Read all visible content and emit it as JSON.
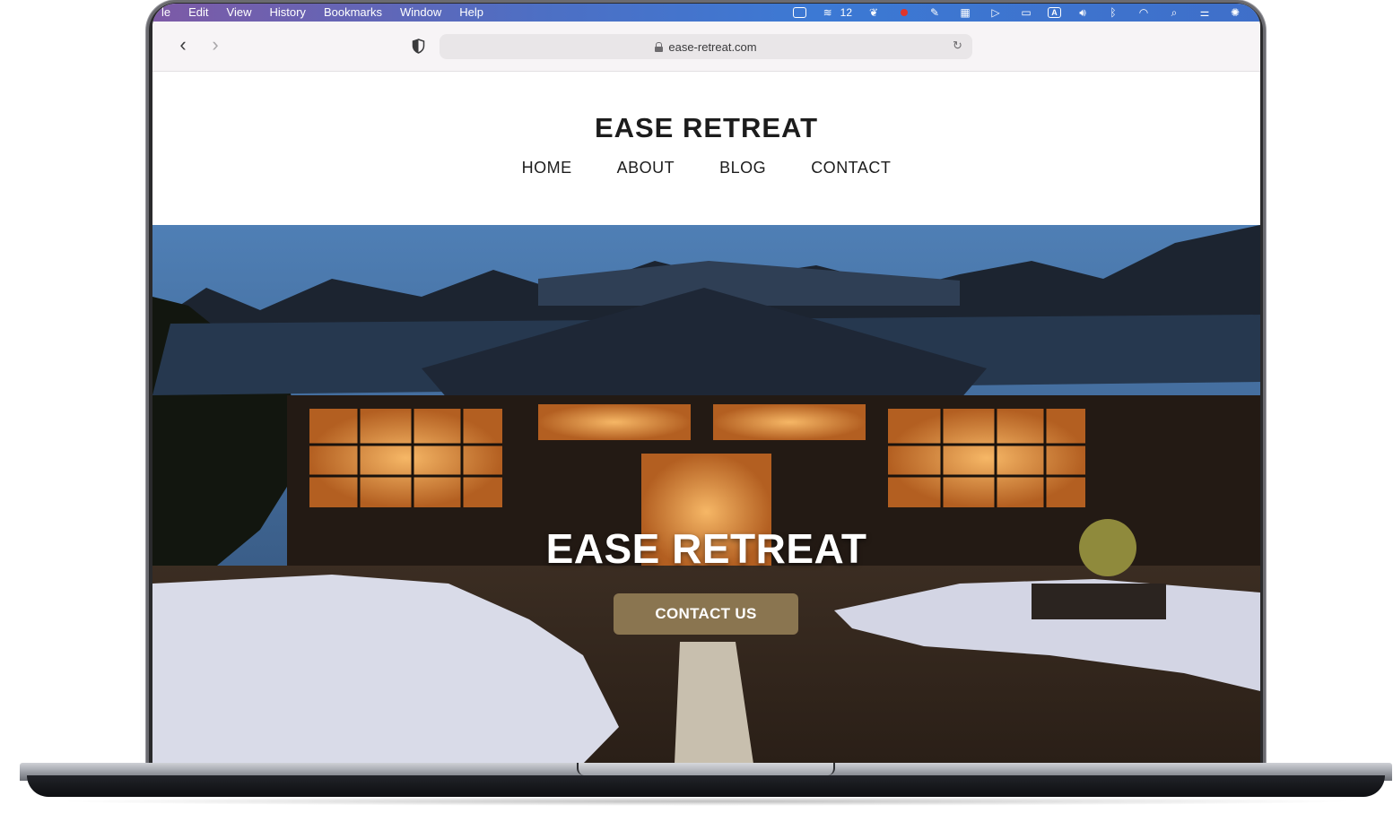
{
  "menubar": {
    "items": [
      "le",
      "Edit",
      "View",
      "History",
      "Bookmarks",
      "Window",
      "Help"
    ],
    "status_count": "12",
    "status_keyboard": "A"
  },
  "browser": {
    "url": "ease-retreat.com"
  },
  "site": {
    "title": "EASE RETREAT",
    "nav": [
      "HOME",
      "ABOUT",
      "BLOG",
      "CONTACT"
    ]
  },
  "hero": {
    "title": "EASE RETREAT",
    "button_label": "CONTACT US"
  },
  "colors": {
    "accent_button": "#8a7550",
    "menubar_start": "#7d5aa6",
    "menubar_end": "#3f6fc9"
  }
}
